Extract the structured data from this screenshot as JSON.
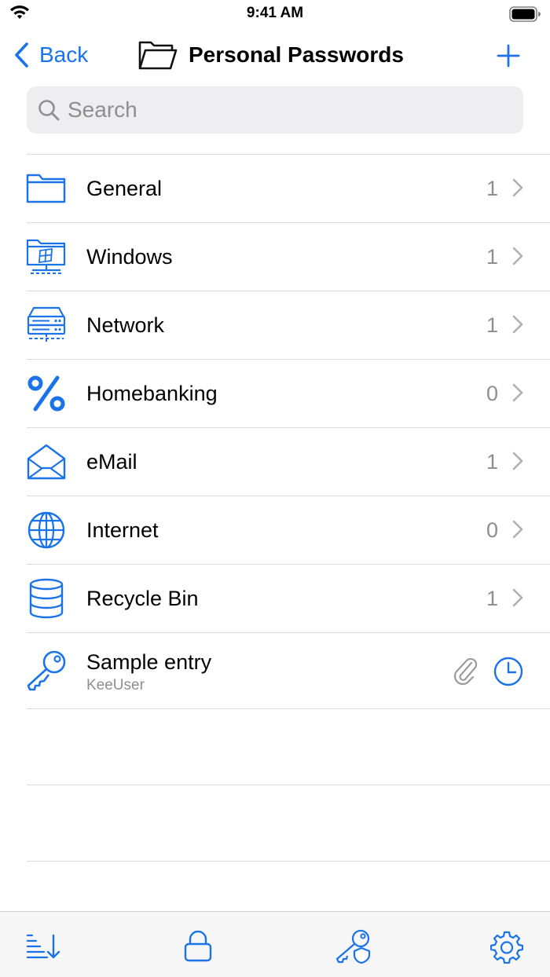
{
  "status_bar": {
    "time": "9:41 AM"
  },
  "nav": {
    "back_label": "Back",
    "title": "Personal Passwords"
  },
  "search": {
    "placeholder": "Search",
    "value": ""
  },
  "groups": [
    {
      "label": "General",
      "count": "1",
      "icon": "folder-icon"
    },
    {
      "label": "Windows",
      "count": "1",
      "icon": "windows-computer-icon"
    },
    {
      "label": "Network",
      "count": "1",
      "icon": "network-server-icon"
    },
    {
      "label": "Homebanking",
      "count": "0",
      "icon": "percent-icon"
    },
    {
      "label": "eMail",
      "count": "1",
      "icon": "envelope-icon"
    },
    {
      "label": "Internet",
      "count": "0",
      "icon": "globe-icon"
    },
    {
      "label": "Recycle Bin",
      "count": "1",
      "icon": "database-icon"
    }
  ],
  "entries": [
    {
      "title": "Sample entry",
      "username": "KeeUser",
      "icon": "key-icon"
    }
  ],
  "colors": {
    "accent": "#1a73e8",
    "secondary_text": "#8e8e93",
    "separator": "#dcdcde"
  },
  "toolbar": {
    "items": [
      "sort-icon",
      "lock-icon",
      "key-shield-icon",
      "gear-icon"
    ]
  }
}
